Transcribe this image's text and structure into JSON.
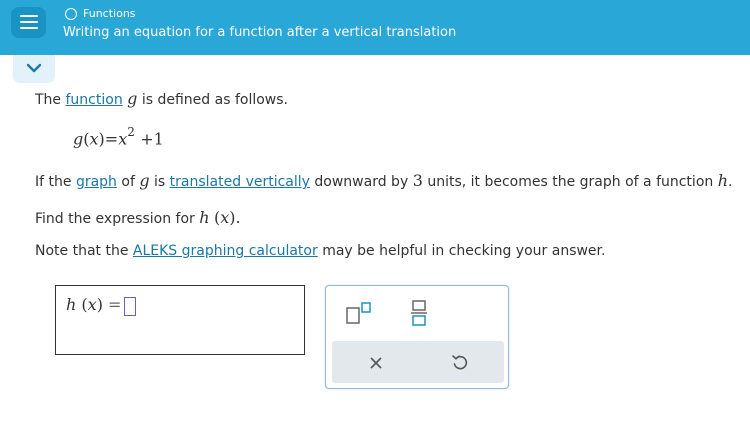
{
  "header": {
    "topic": "Functions",
    "title": "Writing an equation for a function after a vertical translation"
  },
  "problem": {
    "line1": {
      "pre": "The ",
      "link_function": "function",
      "var_g": "g",
      "post": " is defined as follows."
    },
    "equation": {
      "g": "g",
      "lparen": "(",
      "x": "x",
      "rparen": ")",
      "eq": "=",
      "x2": "x",
      "exp": "2",
      "plus": "+",
      "one": "1"
    },
    "line3": {
      "pre": "If the ",
      "link_graph": "graph",
      "of": " of ",
      "var_g": "g",
      "is": " is ",
      "link_translated": "translated vertically",
      "mid": " downward by ",
      "num": "3",
      "post": " units, it becomes the graph of a function ",
      "var_h": "h",
      "end": "."
    },
    "line4": {
      "pre": "Find the expression for ",
      "h": "h",
      "lparen": "(",
      "x": "x",
      "rparen": ")",
      "end": "."
    },
    "line5": {
      "pre": "Note that the ",
      "link_calc": "ALEKS graphing calculator",
      "post": " may be helpful in checking your answer."
    }
  },
  "answer": {
    "h": "h",
    "lparen": "(",
    "x": "x",
    "rparen": ")",
    "eq": "=",
    "value": ""
  },
  "colors": {
    "header": "#29a7d7",
    "link": "#1978a8",
    "input_border": "#6a5acd"
  },
  "icons": {
    "menu": "hamburger-icon",
    "collapse": "chevron-down-icon",
    "superscript": "superscript-icon",
    "fraction": "fraction-icon",
    "clear": "close-icon",
    "undo": "undo-icon"
  }
}
